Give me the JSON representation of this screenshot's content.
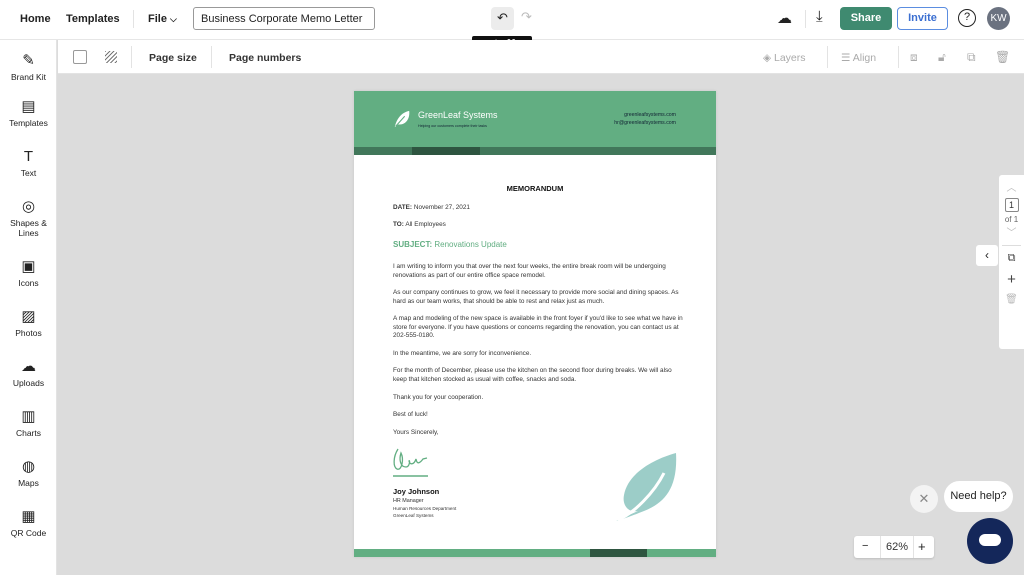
{
  "topbar": {
    "home": "Home",
    "templates": "Templates",
    "file": "File",
    "document_title": "Business Corporate Memo Letter",
    "undo_tooltip": "Undo ⌘ Z",
    "share": "Share",
    "invite": "Invite",
    "help": "?",
    "avatar_initials": "KW"
  },
  "sidebar": {
    "items": [
      {
        "label": "Brand Kit",
        "icon": "✎"
      },
      {
        "label": "Templates",
        "icon": "▤"
      },
      {
        "label": "Text",
        "icon": "T"
      },
      {
        "label": "Shapes & Lines",
        "icon": "◎"
      },
      {
        "label": "Icons",
        "icon": "▣"
      },
      {
        "label": "Photos",
        "icon": "▨"
      },
      {
        "label": "Uploads",
        "icon": "☁"
      },
      {
        "label": "Charts",
        "icon": "▥"
      },
      {
        "label": "Maps",
        "icon": "◍"
      },
      {
        "label": "QR Code",
        "icon": "▦"
      }
    ]
  },
  "toolbar": {
    "page_size": "Page size",
    "page_numbers": "Page numbers",
    "layers": "Layers",
    "align": "Align"
  },
  "memo": {
    "company": "GreenLeaf Systems",
    "tagline": "Helping our customers complete their tasks",
    "website": "greenleafsystems.com",
    "email": "hr@greenleafsystems.com",
    "heading": "MEMORANDUM",
    "date_label": "DATE:",
    "date": "November 27, 2021",
    "to_label": "TO:",
    "to": "All Employees",
    "subject_label": "SUBJECT:",
    "subject": "Renovations Update",
    "paragraphs": [
      "I am writing to inform you that over the next four weeks, the entire break room will be undergoing renovations as part of our entire office space remodel.",
      "As our company continues to grow, we feel it necessary to provide more social and dining spaces. As hard as our team works, that should be able to rest and relax just as much.",
      "A map and modeling of the new space is available in the front foyer if you'd like to see what we have in store for everyone. If you have questions or concerns regarding the renovation, you can contact us at 202-555-0180.",
      "In the meantime, we are sorry for inconvenience.",
      "For the month of December, please use the kitchen on the second floor during breaks. We will also keep that kitchen stocked as usual with coffee, snacks and soda.",
      "Thank you for your cooperation.",
      "Best of luck!",
      "Yours Sincerely,"
    ],
    "signer_name": "Joy Johnson",
    "signer_title": "HR Manager",
    "signer_dept": "Human Resources Department",
    "signer_company": "GreenLeaf Systems"
  },
  "colors": {
    "header_green": "#62ae82",
    "strip_dark": "#41775a",
    "strip_darker": "#2e5540",
    "leaf": "#9ccdc8",
    "share": "#3f8a70",
    "chat": "#14275a"
  },
  "pages": {
    "current": "1",
    "of": "of 1"
  },
  "zoom": {
    "level": "62%",
    "minus": "−",
    "plus": "+"
  },
  "help_bubble": "Need help?"
}
